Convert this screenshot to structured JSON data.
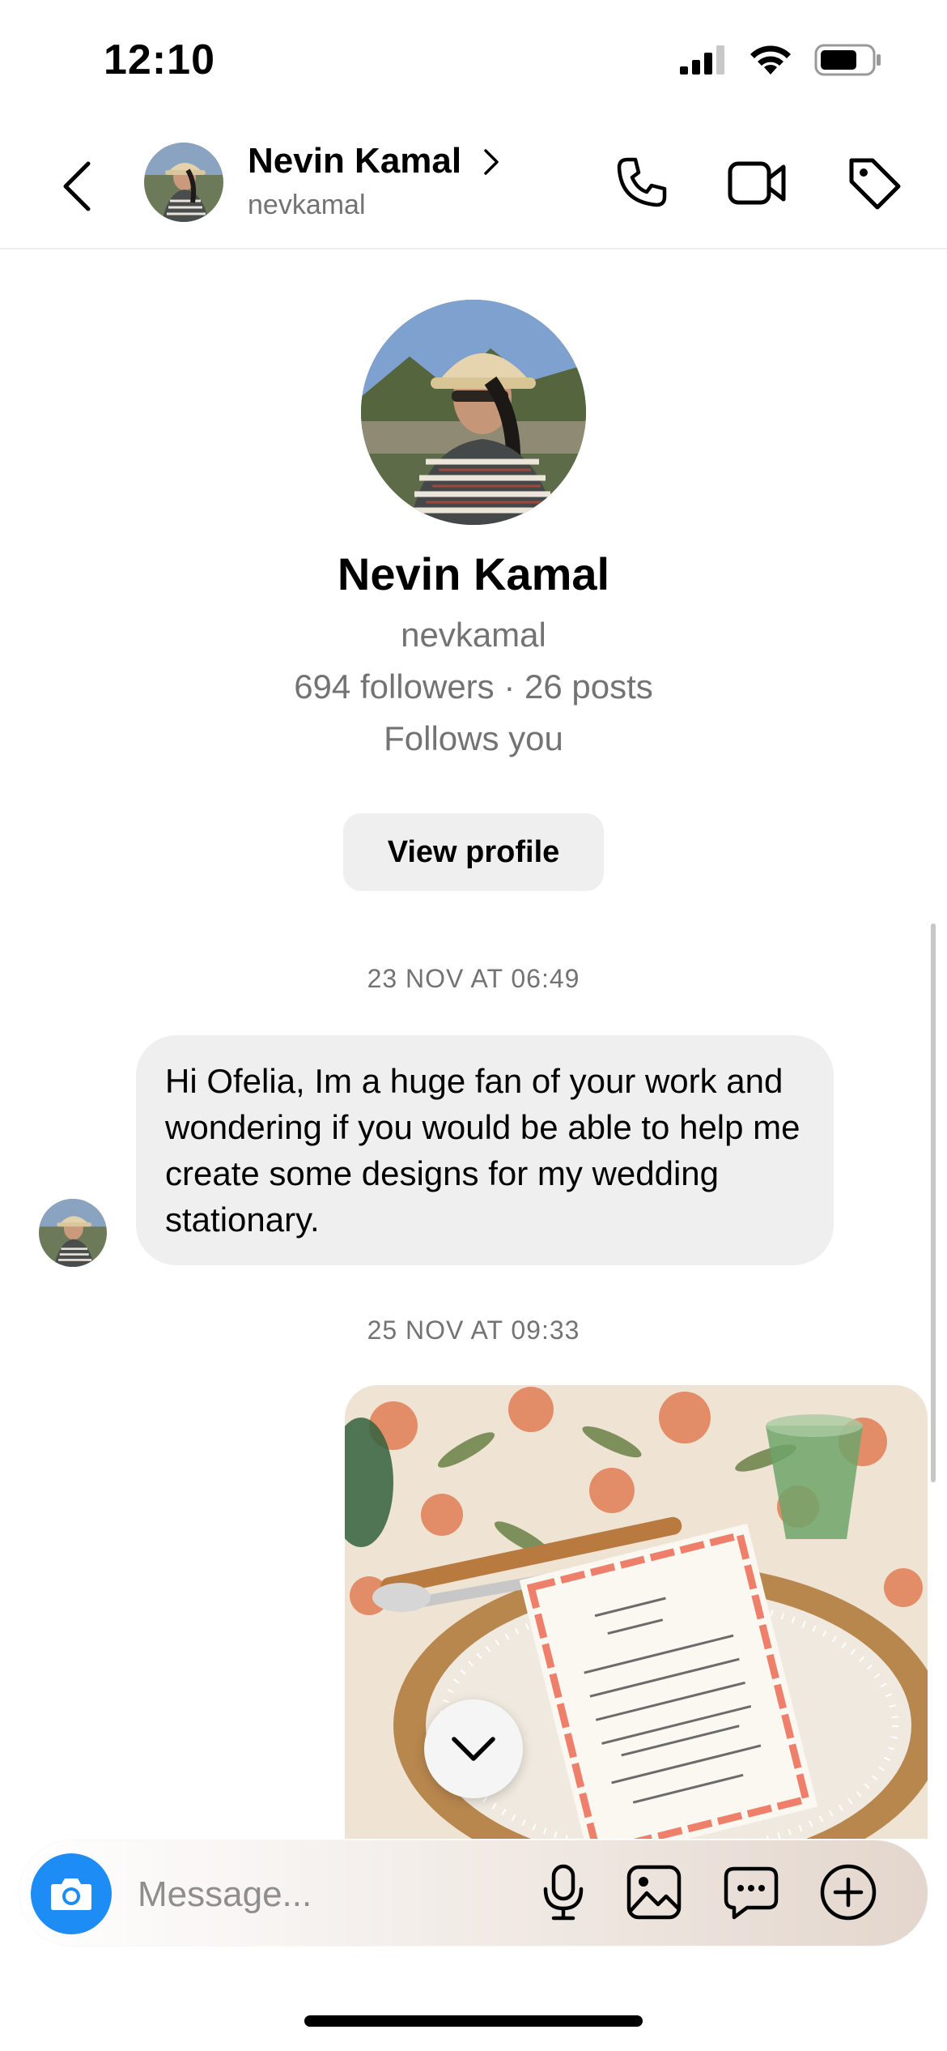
{
  "status_bar": {
    "time": "12:10"
  },
  "header": {
    "name": "Nevin Kamal",
    "username": "nevkamal"
  },
  "profile": {
    "name": "Nevin Kamal",
    "username": "nevkamal",
    "stats": "694 followers · 26 posts",
    "follows_you": "Follows you",
    "view_profile_label": "View profile"
  },
  "thread": {
    "timestamp_1": "23 NOV AT 06:49",
    "message_1": "Hi Ofelia, Im a huge fan of your work and wondering if you would be able to help me create some designs for my wedding stationary.",
    "timestamp_2": "25 NOV AT 09:33"
  },
  "composer": {
    "placeholder": "Message..."
  },
  "colors": {
    "accent": "#1d8cf5",
    "bubble": "#efefef",
    "secondary_text": "#737373"
  }
}
